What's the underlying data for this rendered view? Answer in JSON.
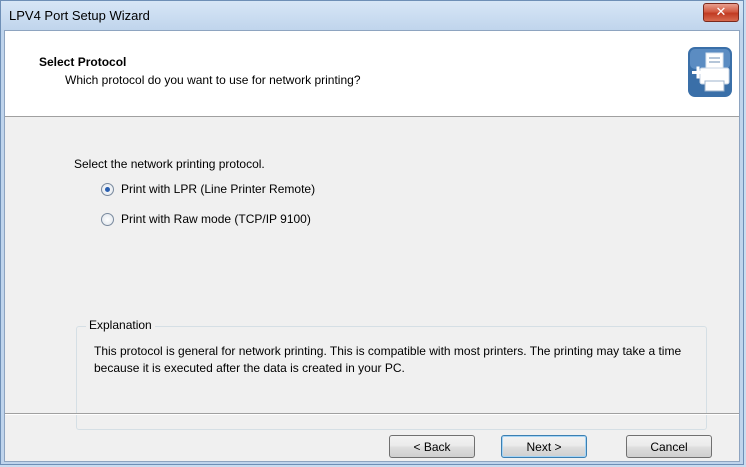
{
  "window": {
    "title": "LPV4 Port Setup Wizard",
    "close_glyph": "✕"
  },
  "header": {
    "title": "Select Protocol",
    "subtitle": "Which protocol do you want to use for network printing?",
    "icon": "printer-add-icon"
  },
  "body": {
    "lead": "Select the network printing protocol.",
    "options": [
      {
        "label": "Print with LPR (Line Printer Remote)",
        "checked": true
      },
      {
        "label": "Print with Raw mode (TCP/IP 9100)",
        "checked": false
      }
    ],
    "explanation": {
      "label": "Explanation",
      "text": "This protocol is general for network printing. This is compatible with most printers. The printing may take a time because it is executed after the data is created in your PC."
    }
  },
  "buttons": {
    "back": "< Back",
    "next": "Next >",
    "cancel": "Cancel"
  },
  "colors": {
    "title_bar": "#c9dcf0",
    "close_button": "#c13b22",
    "content_bg": "#f0f0f0",
    "header_bg": "#ffffff",
    "icon_blue": "#3a6fa8"
  }
}
